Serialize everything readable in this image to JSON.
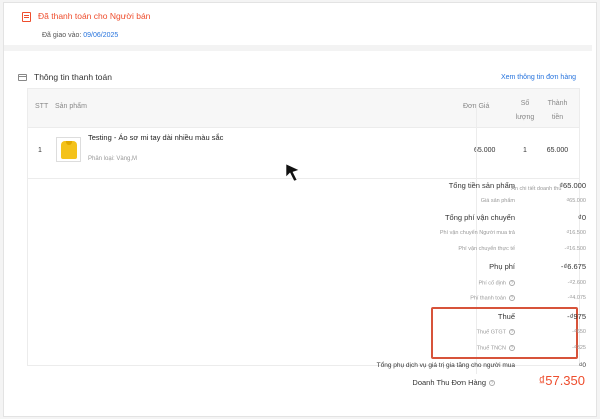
{
  "status": {
    "title": "Đã thanh toán cho Người bán",
    "delivered_label": "Đã giao vào:",
    "delivered_date": "09/06/2025"
  },
  "payment": {
    "title": "Thông tin thanh toán",
    "view_order_link": "Xem thông tin đơn hàng"
  },
  "table": {
    "headers": {
      "stt": "STT",
      "product": "Sản phẩm",
      "price": "Đơn Giá",
      "qty_line1": "Số",
      "qty_line2": "lượng",
      "total_line1": "Thành",
      "total_line2": "tiền"
    },
    "rows": [
      {
        "stt": "1",
        "name": "Testing - Áo sơ mi tay dài nhiều màu sắc",
        "variation": "Phân loại: Vàng,M",
        "price": "65.000",
        "qty": "1",
        "total": "65.000"
      }
    ]
  },
  "hide_revenue_label": "Ẩn chi tiết doanh thu",
  "summary": {
    "subtotal_label": "Tổng tiền sản phẩm",
    "subtotal_value": "₫65.000",
    "product_price_label": "Giá sản phẩm",
    "product_price_value": "₫65.000",
    "shipping_total_label": "Tổng phí vận chuyển",
    "shipping_total_value": "₫0",
    "buyer_shipping_label": "Phí vận chuyển Người mua trả",
    "buyer_shipping_value": "₫16.500",
    "actual_shipping_label": "Phí vận chuyển thực tế",
    "actual_shipping_value": "-₫16.500",
    "fees_label": "Phụ phí",
    "fees_value": "-₫6.675",
    "fixed_fee_label": "Phí cố định",
    "fixed_fee_value": "-₫2.600",
    "payment_fee_label": "Phí thanh toán",
    "payment_fee_value": "-₫4.075",
    "tax_label": "Thuế",
    "tax_value": "-₫975",
    "vat_label": "Thuế GTGT",
    "vat_value": "-₫650",
    "pit_label": "Thuế TNCN",
    "pit_value": "-₫325",
    "value_added_label": "Tổng phụ dịch vụ giá trị gia tăng cho người mua",
    "value_added_value": "₫0",
    "revenue_label": "Doanh Thu Đơn Hàng",
    "revenue_value": "₫57.350"
  },
  "colors": {
    "accent": "#ee4d2d",
    "link": "#2673dd",
    "highlight_box": "#d7533a"
  },
  "icons": [
    "receipt-icon",
    "payment-card-icon",
    "info-icon",
    "chevron-up-icon",
    "mouse-pointer-icon"
  ]
}
